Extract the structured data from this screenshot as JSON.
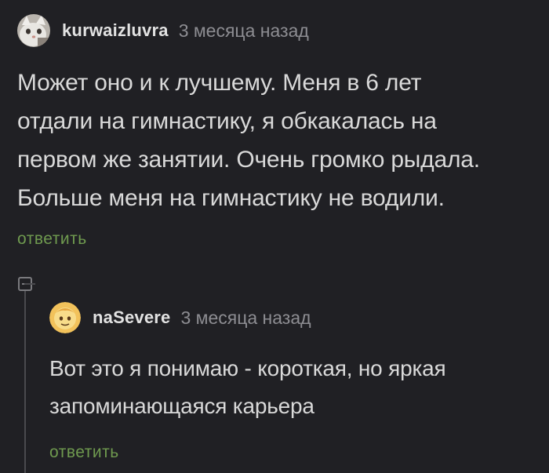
{
  "comments": [
    {
      "username": "kurwaizluvra",
      "timestamp": "3 месяца назад",
      "text": "Может оно и к лучшему. Меня в 6 лет\nотдали на гимнастику, я обкакалась на\nпервом же занятии. Очень громко рыдала.\nБольше меня на гимнастику не водили.",
      "reply_label": "ответить",
      "avatar": "cat-avatar-icon"
    },
    {
      "username": "naSevere",
      "timestamp": "3 месяца назад",
      "text": "Вот это я понимаю - короткая, но яркая\nзапоминающаяся карьера",
      "reply_label": "ответить",
      "avatar": "emoji-face-avatar-icon"
    }
  ],
  "colors": {
    "background": "#202024",
    "text": "#d9d9d9",
    "muted": "#8d8d92",
    "reply": "#6f9a4f"
  }
}
